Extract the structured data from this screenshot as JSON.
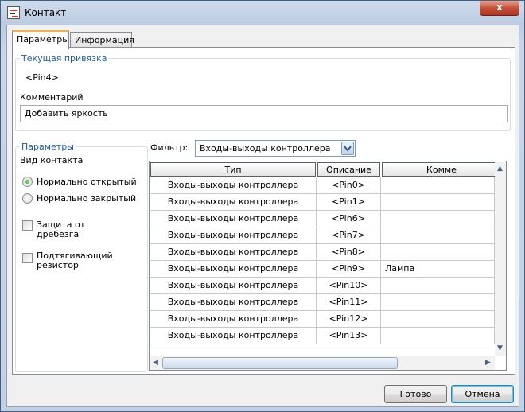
{
  "window": {
    "title": "Контакт",
    "close_label": "x"
  },
  "tabs": [
    {
      "label": "Параметры",
      "active": true
    },
    {
      "label": "Информация",
      "active": false
    }
  ],
  "binding": {
    "group_title": "Текущая привязка",
    "value": "<Pin4>"
  },
  "comment": {
    "label": "Комментарий",
    "value": "Добавить яркость"
  },
  "params": {
    "group_title": "Параметры",
    "contact_type_label": "Вид контакта",
    "radio_no": {
      "label": "Нормально открытый",
      "checked": true
    },
    "radio_nc": {
      "label": "Нормально закрытый",
      "checked": false
    },
    "debounce": {
      "line1": "Защита от",
      "line2": "дребезга",
      "checked": false
    },
    "pullup": {
      "line1": "Подтягивающий",
      "line2": "резистор",
      "checked": false
    }
  },
  "filter": {
    "label": "Фильтр:",
    "value": "Входы-выходы контроллера"
  },
  "table": {
    "columns": [
      "Тип",
      "Описание",
      "Комме"
    ],
    "rows": [
      {
        "type": "Входы-выходы контроллера",
        "desc": "<Pin0>",
        "comment": ""
      },
      {
        "type": "Входы-выходы контроллера",
        "desc": "<Pin1>",
        "comment": ""
      },
      {
        "type": "Входы-выходы контроллера",
        "desc": "<Pin6>",
        "comment": ""
      },
      {
        "type": "Входы-выходы контроллера",
        "desc": "<Pin7>",
        "comment": ""
      },
      {
        "type": "Входы-выходы контроллера",
        "desc": "<Pin8>",
        "comment": ""
      },
      {
        "type": "Входы-выходы контроллера",
        "desc": "<Pin9>",
        "comment": "Лампа"
      },
      {
        "type": "Входы-выходы контроллера",
        "desc": "<Pin10>",
        "comment": ""
      },
      {
        "type": "Входы-выходы контроллера",
        "desc": "<Pin11>",
        "comment": ""
      },
      {
        "type": "Входы-выходы контроллера",
        "desc": "<Pin12>",
        "comment": ""
      },
      {
        "type": "Входы-выходы контроллера",
        "desc": "<Pin13>",
        "comment": ""
      }
    ]
  },
  "buttons": {
    "ok": "Готово",
    "cancel": "Отмена"
  },
  "colors": {
    "group_title": "#1d5aab",
    "active_tab_accent": "#f3b34a",
    "close_button": "#c4513a"
  }
}
